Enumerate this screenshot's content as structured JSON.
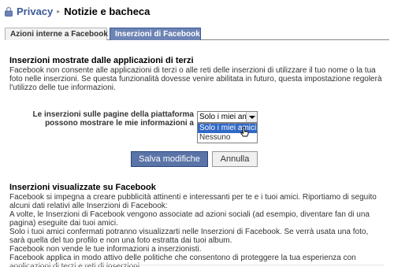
{
  "breadcrumb": {
    "root": "Privacy",
    "separator": "▸",
    "current": "Notizie e bacheca"
  },
  "tabs": [
    {
      "label": "Azioni interne a Facebook",
      "active": false
    },
    {
      "label": "Inserzioni di Facebook",
      "active": true
    }
  ],
  "third_party": {
    "title": "Inserzioni mostrate dalle applicazioni di terzi",
    "body": "Facebook non consente alle applicazioni di terzi o alle reti delle inserzioni di utilizzare il tuo nome o la tua foto nelle inserzioni. Se questa funzionalità dovesse venire abilitata in futuro, questa impostazione regolerà l'utilizzo delle tue informazioni."
  },
  "setting": {
    "label": "Le inserzioni sulle pagine della piattaforma possono mostrare le mie informazioni a",
    "selected_value": "Solo i miei amici",
    "options": [
      "Solo i miei amici",
      "Nessuno"
    ]
  },
  "buttons": {
    "save": "Salva modifiche",
    "cancel": "Annulla"
  },
  "facebook_ads": {
    "title": "Inserzioni visualizzate su Facebook",
    "paragraphs": [
      "Facebook si impegna a creare pubblicità attinenti e interessanti per te e i tuoi amici. Riportiamo di seguito alcuni dati relativi alle Inserzioni di Facebook:",
      "A volte, le Inserzioni di Facebook vengono associate ad azioni sociali (ad esempio, diventare fan di una pagina) eseguite dai tuoi amici.",
      "Solo i tuoi amici confermati potranno visualizzarti nelle Inserzioni di Facebook. Se verrà usata una foto, sarà quella del tuo profilo e non una foto estratta dai tuoi album.",
      "Facebook non vende le tue informazioni a inserzionisti.",
      "Facebook applica in modo attivo delle politiche che consentono di proteggere la tua esperienza con applicazioni di terzi e reti di inserzioni."
    ]
  },
  "colors": {
    "brand": "#3b5998",
    "active_tab": "#6d84b4",
    "save_button": "#5b74a8",
    "dropdown_highlight": "#3169c6"
  },
  "icons": {
    "lock": "lock-icon",
    "dropdown": "chevron-down-icon",
    "cursor": "mouse-pointer-icon"
  }
}
